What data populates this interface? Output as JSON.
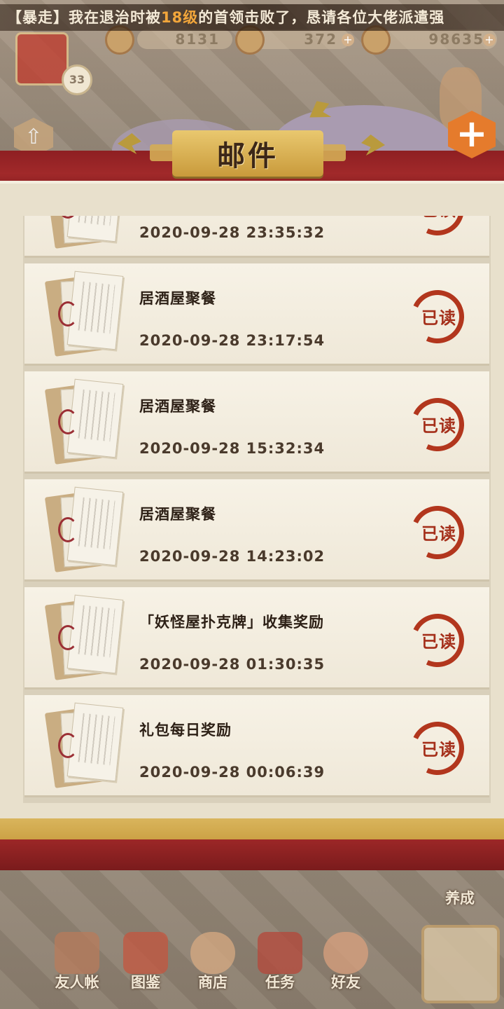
{
  "marquee": {
    "part1": "【暴走】我在退治时被",
    "level": "18级",
    "part2": "的首领击败了，恳请各位大佬派遣强"
  },
  "resources": [
    {
      "value": "8131"
    },
    {
      "value": "372"
    },
    {
      "value": "98635"
    }
  ],
  "player": {
    "level": "33"
  },
  "header": {
    "title": "邮件",
    "close_icon": "+"
  },
  "mails": [
    {
      "subject": "",
      "time": "2020-09-28 23:35:32",
      "status": "已读"
    },
    {
      "subject": "居酒屋聚餐",
      "time": "2020-09-28 23:17:54",
      "status": "已读"
    },
    {
      "subject": "居酒屋聚餐",
      "time": "2020-09-28 15:32:34",
      "status": "已读"
    },
    {
      "subject": "居酒屋聚餐",
      "time": "2020-09-28 14:23:02",
      "status": "已读"
    },
    {
      "subject": "「妖怪屋扑克牌」收集奖励",
      "time": "2020-09-28 01:30:35",
      "status": "已读"
    },
    {
      "subject": "礼包每日奖励",
      "time": "2020-09-28 00:06:39",
      "status": "已读"
    }
  ],
  "bottom_nav": {
    "train": "养成",
    "items": [
      {
        "label": "友人帐"
      },
      {
        "label": "图鉴"
      },
      {
        "label": "商店"
      },
      {
        "label": "任务"
      },
      {
        "label": "好友"
      }
    ]
  },
  "colors": {
    "accent_red": "#a1292a",
    "gold": "#d4ac55",
    "read_stamp": "#b2361d",
    "close_orange": "#e57b2c"
  }
}
